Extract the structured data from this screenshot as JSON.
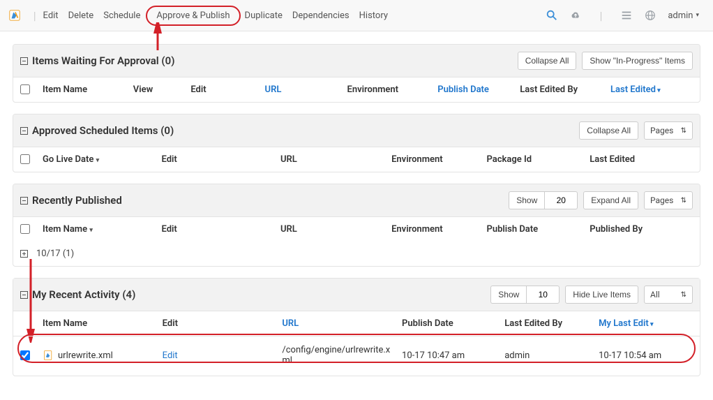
{
  "toolbar": {
    "edit": "Edit",
    "delete": "Delete",
    "schedule": "Schedule",
    "approve_publish": "Approve & Publish",
    "duplicate": "Duplicate",
    "dependencies": "Dependencies",
    "history": "History",
    "admin_user": "admin"
  },
  "sections": {
    "waiting": {
      "title": "Items Waiting For Approval (0)",
      "collapse": "Collapse All",
      "inprogress": "Show \"In-Progress\" Items",
      "cols": {
        "item": "Item Name",
        "view": "View",
        "edit": "Edit",
        "url": "URL",
        "env": "Environment",
        "publish": "Publish Date",
        "editedby": "Last Edited By",
        "lastedited": "Last Edited"
      }
    },
    "scheduled": {
      "title": "Approved Scheduled Items (0)",
      "collapse": "Collapse All",
      "pages": "Pages",
      "cols": {
        "golive": "Go Live Date",
        "edit": "Edit",
        "url": "URL",
        "env": "Environment",
        "package": "Package Id",
        "lastedited": "Last Edited"
      }
    },
    "recent": {
      "title": "Recently Published",
      "show_label": "Show",
      "show_value": "20",
      "expand": "Expand All",
      "pages": "Pages",
      "cols": {
        "item": "Item Name",
        "edit": "Edit",
        "url": "URL",
        "env": "Environment",
        "publish": "Publish Date",
        "publishedby": "Published By"
      },
      "grouped": "10/17 (1)"
    },
    "activity": {
      "title": "My Recent Activity (4)",
      "show_label": "Show",
      "show_value": "10",
      "hide_live": "Hide Live Items",
      "all": "All",
      "cols": {
        "item": "Item Name",
        "edit": "Edit",
        "url": "URL",
        "publish": "Publish Date",
        "editedby": "Last Edited By",
        "mylast": "My Last Edit"
      },
      "row": {
        "item": "urlrewrite.xml",
        "edit": "Edit",
        "url": "/config/engine/urlrewrite.xml",
        "publish": "10-17 10:47 am",
        "editedby": "admin",
        "mylast": "10-17 10:54 am"
      }
    }
  }
}
